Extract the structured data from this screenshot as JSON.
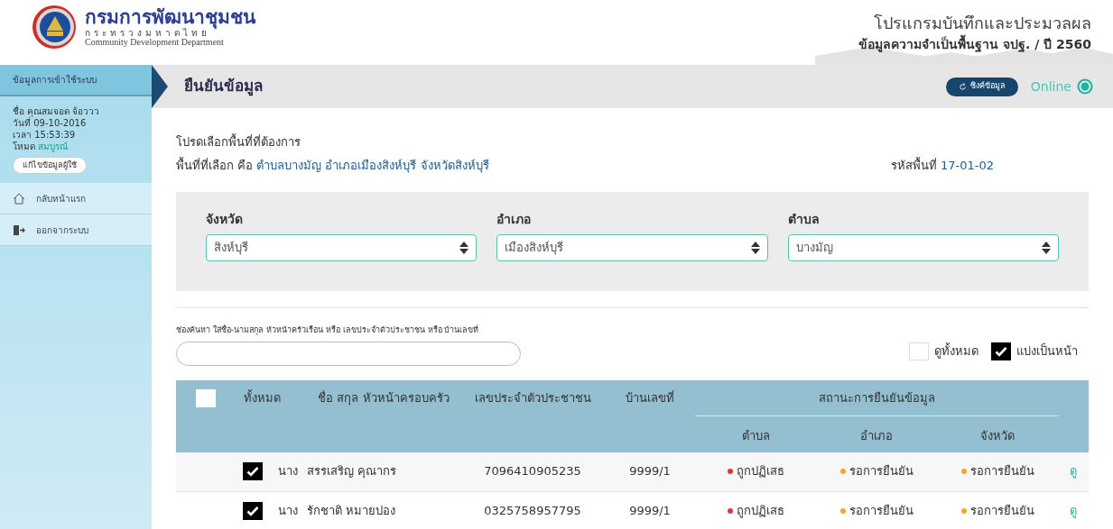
{
  "header": {
    "org_name": "กรมการพัฒนาชุมชน",
    "org_ministry": "กระทรวงมหาดไทย",
    "org_english": "Community Development Department",
    "program_title": "โปรแกรมบันทึกและประมวลผล",
    "program_subtitle": "ข้อมูลความจำเป็นพื้นฐาน จปฐ. / ปี 2560"
  },
  "sidebar": {
    "heading": "ข้อมูลการเข้าใช้ระบบ",
    "user_lines": [
      {
        "label": "ชื่อ",
        "value": "คุณสมจอด จ้อววว",
        "highlight": false
      },
      {
        "label": "วันที่",
        "value": "09-10-2016",
        "highlight": false
      },
      {
        "label": "เวลา",
        "value": "15:53:39",
        "highlight": false
      },
      {
        "label": "โหมด",
        "value": "สมบูรณ์",
        "highlight": true
      }
    ],
    "edit_button": "แก้ไขข้อมูลผู้ใช้",
    "items": [
      {
        "kind": "home",
        "label": "กลับหน้าแรก"
      },
      {
        "kind": "logout",
        "label": "ออกจากระบบ"
      }
    ]
  },
  "page": {
    "title": "ยืนยันข้อมูล",
    "sync_button": "ซิงค์ข้อมูล",
    "status": "Online",
    "online": true
  },
  "area": {
    "prompt": "โปรดเลือกพื้นที่ที่ต้องการ",
    "selected_label": "พื้นที่ที่เลือก คือ",
    "selected_value": "ตำบลบางมัญ อำเภอเมืองสิงห์บุรี จังหวัดสิงห์บุรี",
    "code_label": "รหัสพื้นที่",
    "code_value": "17-01-02"
  },
  "filters": [
    {
      "label": "จังหวัด",
      "value": "สิงห์บุรี"
    },
    {
      "label": "อำเภอ",
      "value": "เมืองสิงห์บุรี"
    },
    {
      "label": "ตำบล",
      "value": "บางมัญ"
    }
  ],
  "search": {
    "label": "ช่องค้นหา ใส่ชื่อ-นามสกุล หัวหน้าครัวเรือน หรือ เลขประจำตัวประชาชน หรือ บ้านเลขที่"
  },
  "view_options": [
    {
      "label": "ดูทั้งหมด",
      "checked": false
    },
    {
      "label": "แบ่งเป็นหน้า",
      "checked": true
    }
  ],
  "table": {
    "select_all": {
      "checked": false
    },
    "columns": [
      "ทั้งหมด",
      "ชื่อ สกุล หัวหน้าครอบครัว",
      "เลขประจำตัวประชาชน",
      "บ้านเลขที่"
    ],
    "status_group": "สถานะการยืนยันข้อมูล",
    "status_columns": [
      "ตำบล",
      "อำเภอ",
      "จังหวัด"
    ],
    "rows": [
      {
        "checked": true,
        "prefix": "นาง",
        "name": "สรรเสริญ คุณากร",
        "citizen_id": "7096410905235",
        "house_no": "9999/1",
        "statuses": [
          {
            "text": "ถูกปฏิเสธ",
            "color": "#d9363e"
          },
          {
            "text": "รอการยืนยัน",
            "color": "#f5a623"
          },
          {
            "text": "รอการยืนยัน",
            "color": "#f5a623"
          }
        ],
        "action": "ดู"
      },
      {
        "checked": true,
        "prefix": "นาง",
        "name": "รักชาติ หมายปอง",
        "citizen_id": "0325758957795",
        "house_no": "9999/1",
        "statuses": [
          {
            "text": "ถูกปฏิเสธ",
            "color": "#d9363e"
          },
          {
            "text": "รอการยืนยัน",
            "color": "#f5a623"
          },
          {
            "text": "รอการยืนยัน",
            "color": "#f5a623"
          }
        ],
        "action": "ดู"
      }
    ]
  }
}
